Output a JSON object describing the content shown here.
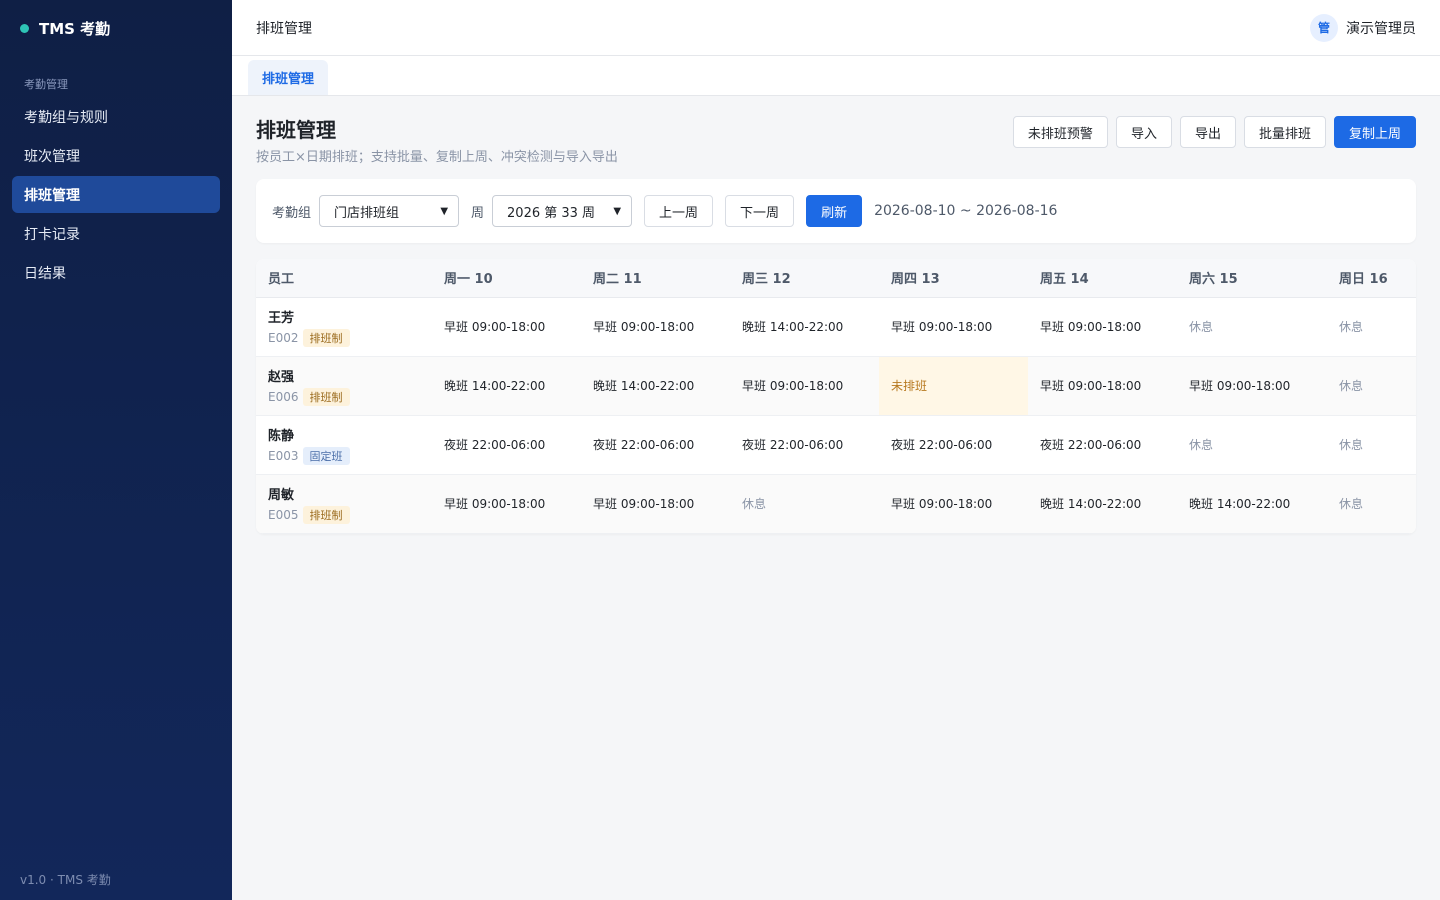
{
  "app": {
    "brand": "TMS 考勤",
    "version": "v1.0 · TMS 考勤"
  },
  "sidebar": {
    "section": "考勤管理",
    "items": [
      {
        "label": "考勤组与规则",
        "active": false
      },
      {
        "label": "班次管理",
        "active": false
      },
      {
        "label": "排班管理",
        "active": true
      },
      {
        "label": "打卡记录",
        "active": false
      },
      {
        "label": "日结果",
        "active": false
      }
    ]
  },
  "header": {
    "title": "排班管理",
    "avatar": "管",
    "user": "演示管理员"
  },
  "tabs": [
    {
      "label": "排班管理"
    }
  ],
  "page": {
    "title": "排班管理",
    "subtitle": "按员工×日期排班；支持批量、复制上周、冲突检测与导入导出",
    "actions": [
      "未排班预警",
      "导入",
      "导出",
      "批量排班",
      "复制上周"
    ]
  },
  "filters": {
    "group_label": "考勤组",
    "group_value": "门店排班组",
    "week_label": "周",
    "week_value": "2026 第 33 周",
    "prev": "上一周",
    "next": "下一周",
    "refresh": "刷新",
    "range": "2026-08-10 ~ 2026-08-16"
  },
  "table": {
    "headers": [
      "员工",
      "周一 10",
      "周二 11",
      "周三 12",
      "周四 13",
      "周五 14",
      "周六 15",
      "周日 16"
    ],
    "rows": [
      {
        "name": "王芳",
        "code": "E002",
        "type": "排班制",
        "cells": [
          "早班 09:00-18:00",
          "早班 09:00-18:00",
          "晚班 14:00-22:00",
          "早班 09:00-18:00",
          "早班 09:00-18:00",
          "休息",
          "休息"
        ]
      },
      {
        "name": "赵强",
        "code": "E006",
        "type": "排班制",
        "cells": [
          "晚班 14:00-22:00",
          "晚班 14:00-22:00",
          "早班 09:00-18:00",
          "未排班",
          "早班 09:00-18:00",
          "早班 09:00-18:00",
          "休息"
        ]
      },
      {
        "name": "陈静",
        "code": "E003",
        "type": "固定班",
        "cells": [
          "夜班 22:00-06:00",
          "夜班 22:00-06:00",
          "夜班 22:00-06:00",
          "夜班 22:00-06:00",
          "夜班 22:00-06:00",
          "休息",
          "休息"
        ]
      },
      {
        "name": "周敏",
        "code": "E005",
        "type": "排班制",
        "cells": [
          "早班 09:00-18:00",
          "早班 09:00-18:00",
          "休息",
          "早班 09:00-18:00",
          "晚班 14:00-22:00",
          "晚班 14:00-22:00",
          "休息"
        ]
      }
    ]
  },
  "colors": {
    "primary": "#1d6ae5",
    "sidebar": "#0f1f45",
    "warning_bg": "#fff7e6",
    "warning_text": "#b7791f"
  }
}
